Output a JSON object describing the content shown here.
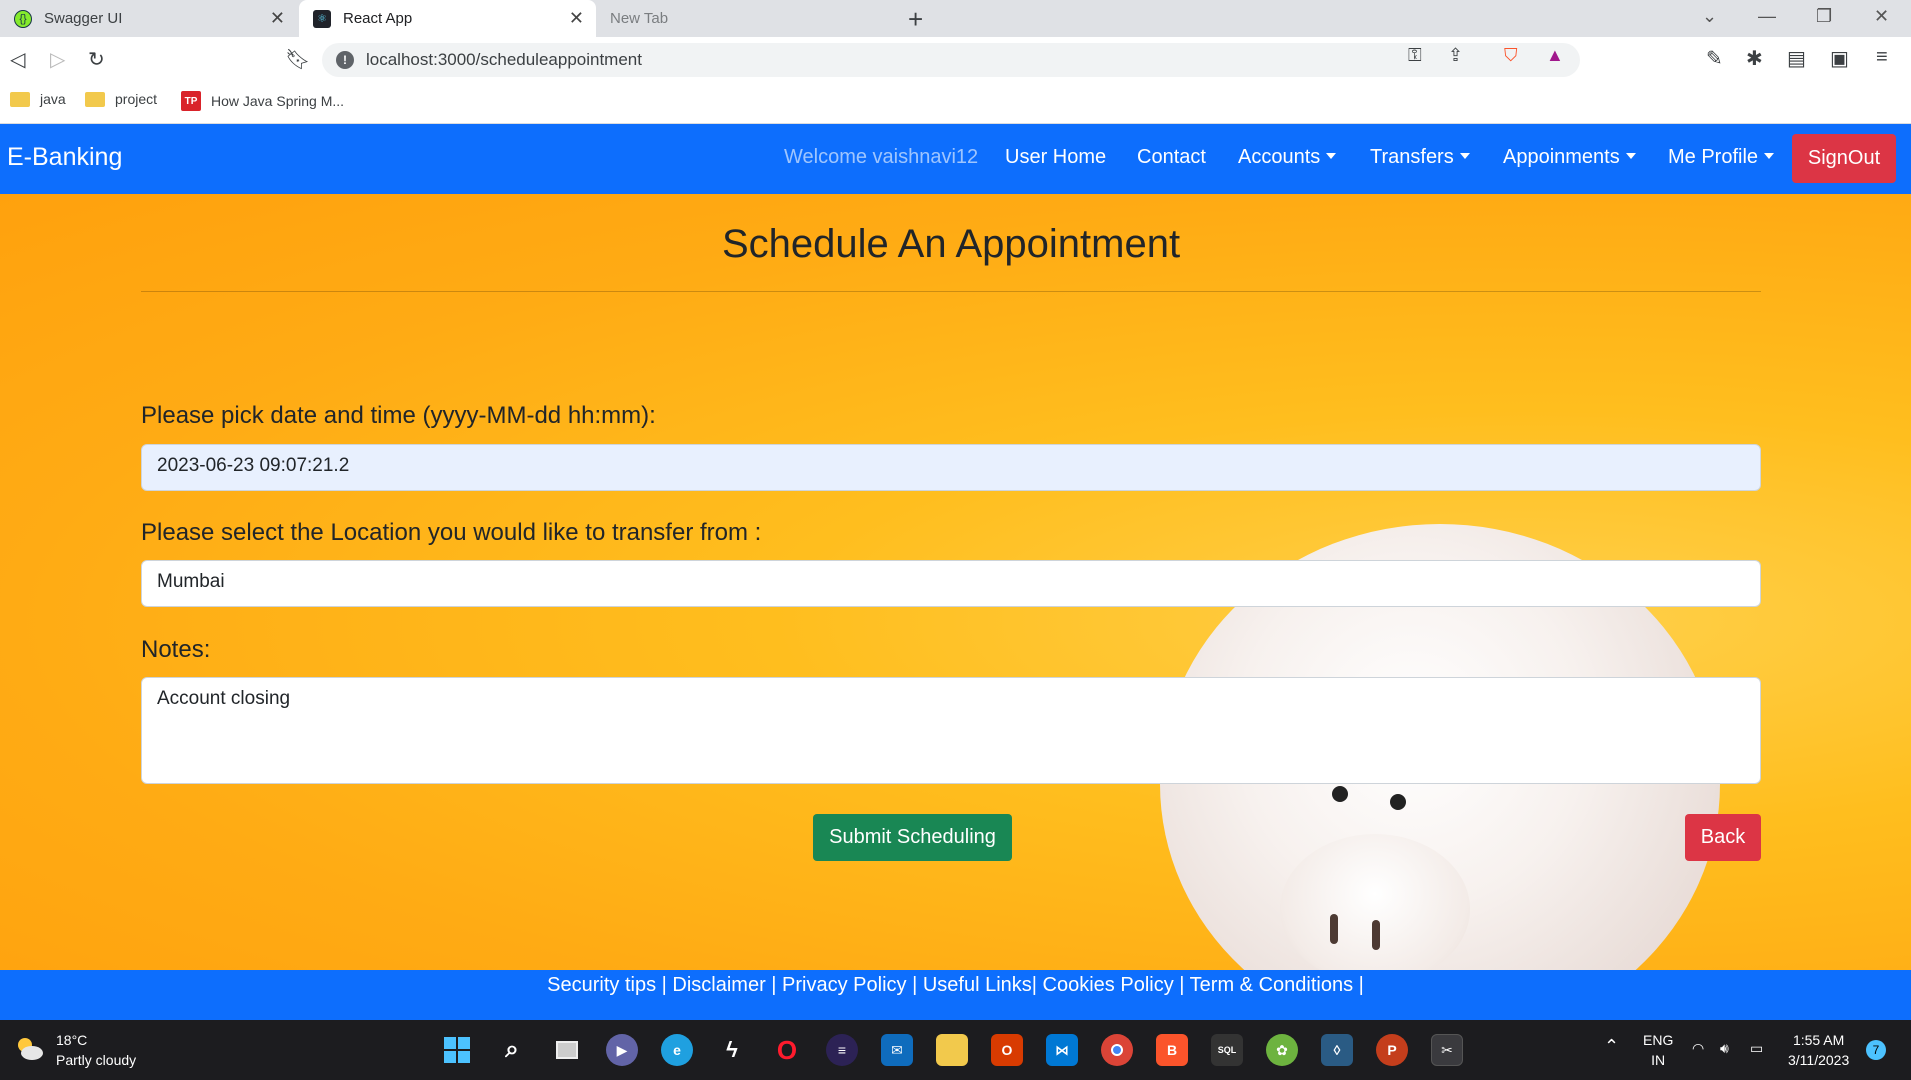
{
  "browser": {
    "tabs": [
      {
        "title": "Swagger UI",
        "active": false
      },
      {
        "title": "React App",
        "active": true
      },
      {
        "title": "New Tab",
        "active": false
      }
    ],
    "url": "localhost:3000/scheduleappointment",
    "bookmarks": [
      "java",
      "project",
      "How Java Spring M..."
    ],
    "bookmark_tp_badge": "TP"
  },
  "navbar": {
    "brand": "E-Banking",
    "welcome": "Welcome vaishnavi12",
    "links": {
      "user_home": "User Home",
      "contact": "Contact",
      "accounts": "Accounts",
      "transfers": "Transfers",
      "appointments": "Appoinments",
      "profile": "Me Profile"
    },
    "signout": "SignOut"
  },
  "form": {
    "title": "Schedule An Appointment",
    "date_label": "Please pick date and time (yyyy-MM-dd hh:mm):",
    "date_value": "2023-06-23 09:07:21.2",
    "location_label": "Please select the Location you would like to transfer from :",
    "location_value": "Mumbai",
    "notes_label": "Notes:",
    "notes_value": "Account closing",
    "submit_label": "Submit Scheduling",
    "back_label": "Back"
  },
  "footer": {
    "links": [
      "Security tips",
      "Disclaimer",
      "Privacy Policy",
      "Useful Links",
      "Cookies Policy",
      "Term & Conditions"
    ]
  },
  "taskbar": {
    "temperature": "18°C",
    "weather": "Partly cloudy",
    "language_line1": "ENG",
    "language_line2": "IN",
    "time": "1:55 AM",
    "date": "3/11/2023",
    "notification_count": "7"
  },
  "colors": {
    "navbar": "#0d6efd",
    "signout": "#dc3545",
    "submit": "#198754",
    "background": "#ffb21a"
  }
}
